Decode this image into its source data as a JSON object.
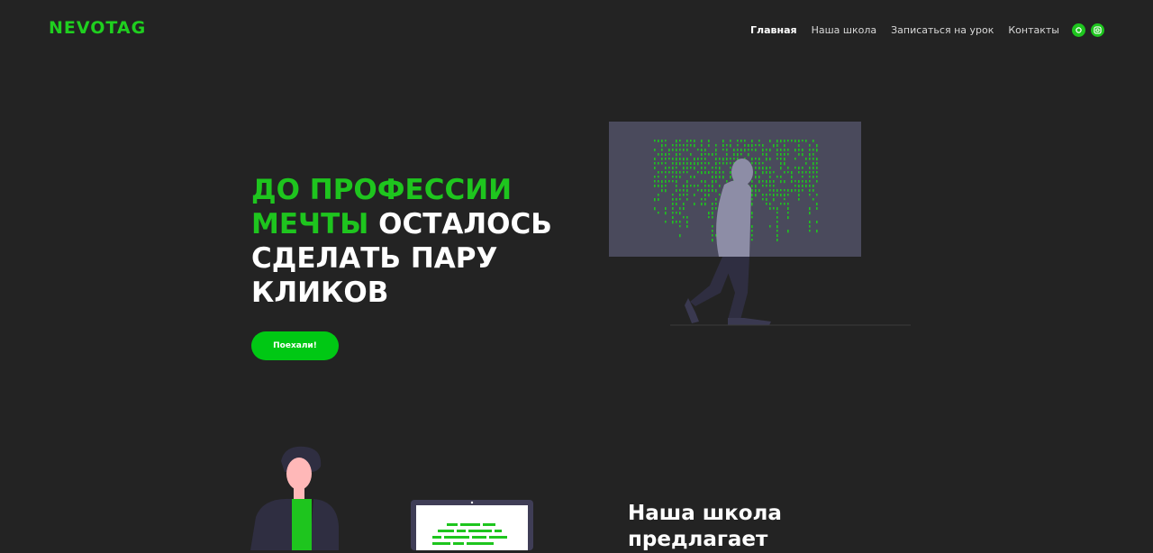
{
  "header": {
    "logo": "NEVOTAG",
    "nav": [
      "Главная",
      "Наша школа",
      "Записаться на урок",
      "Контакты"
    ],
    "social_icons": [
      "chat-icon",
      "instagram-icon"
    ]
  },
  "hero": {
    "title_accent": "ДО ПРОФЕССИИ МЕЧТЫ",
    "title_rest": " ОСТАЛОСЬ СДЕЛАТЬ ПАРУ КЛИКОВ",
    "cta": "Поехали!"
  },
  "section": {
    "title": "Наша школа предлагает"
  },
  "colors": {
    "background": "#232323",
    "accent": "#1ec51e",
    "button": "#00c814",
    "panel": "#4a4a5c"
  }
}
